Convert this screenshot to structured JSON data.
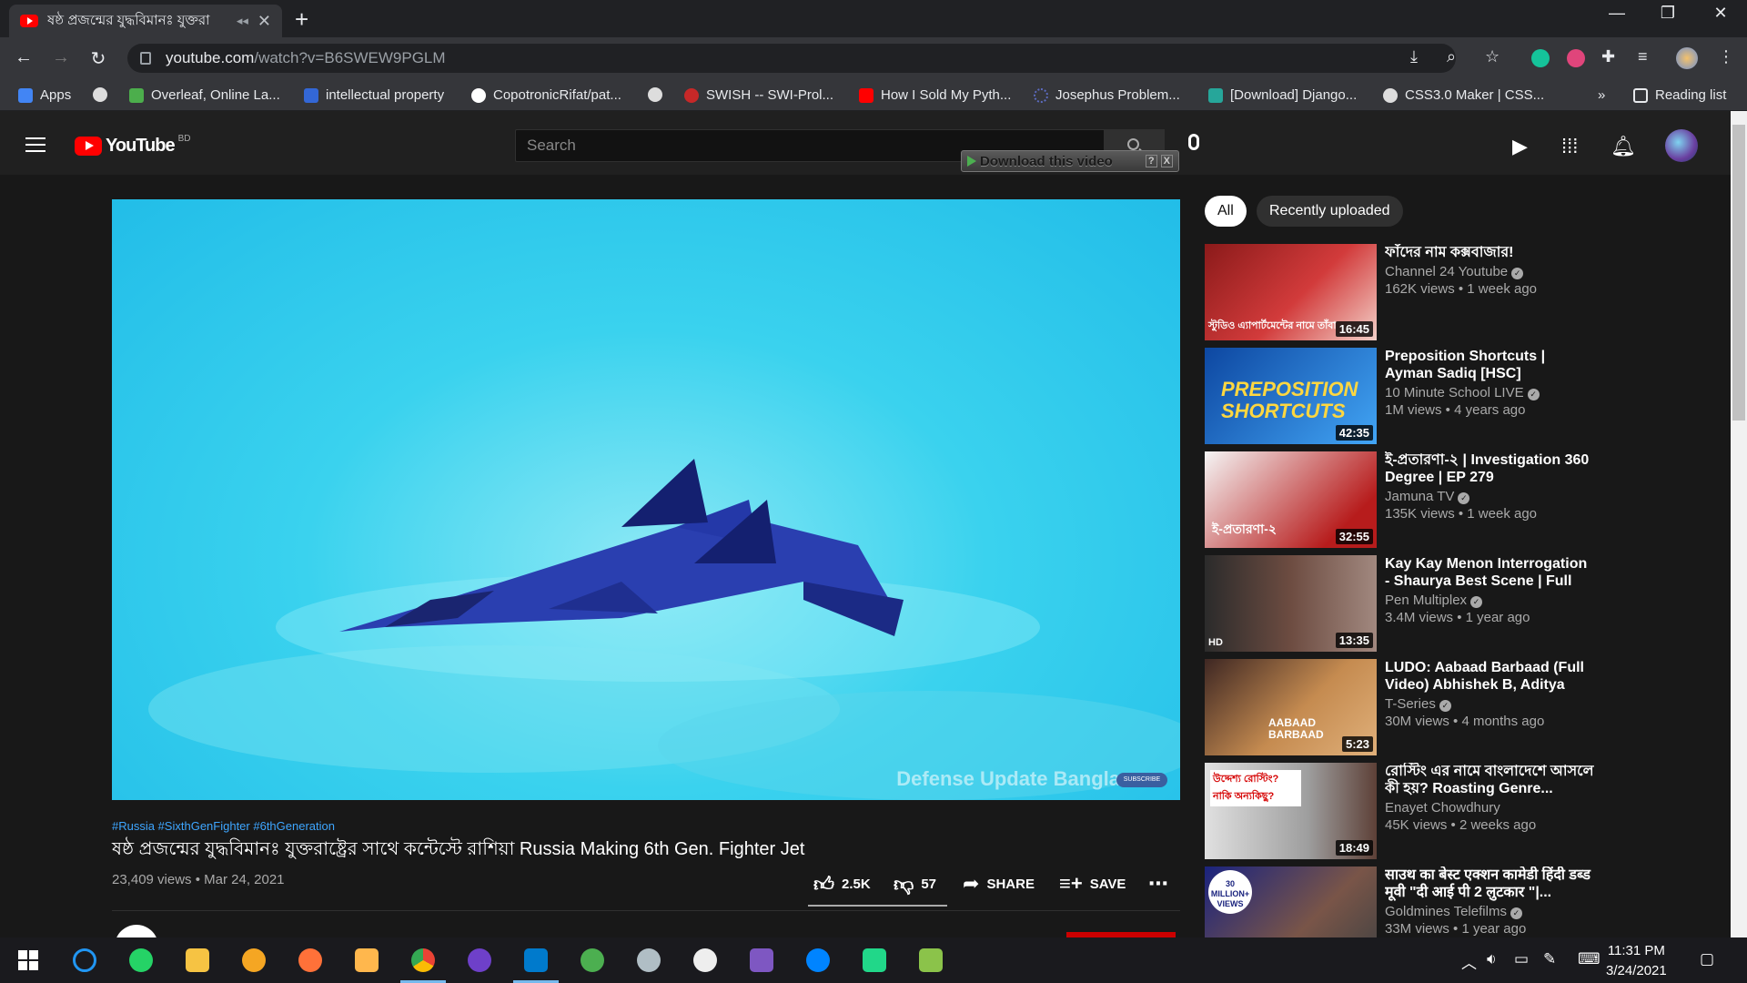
{
  "browser": {
    "tab_title": "ষষ্ঠ প্রজন্মের যুদ্ধবিমানঃ যুক্তরা",
    "url_host": "youtube.com",
    "url_path": "/watch?v=B6SWEW9PGLM",
    "bookmarks": [
      {
        "label": "Apps",
        "color": "#4285f4"
      },
      {
        "label": "",
        "color": "#dddddd"
      },
      {
        "label": "Overleaf, Online La...",
        "color": "#4cae4c"
      },
      {
        "label": "intellectual property",
        "color": "#3367d6"
      },
      {
        "label": "CopotronicRifat/pat...",
        "color": "#ffffff"
      },
      {
        "label": "",
        "color": "#dddddd"
      },
      {
        "label": "SWISH -- SWI-Prol...",
        "color": "#c62828"
      },
      {
        "label": "How I Sold My Pyth...",
        "color": "#ff0000"
      },
      {
        "label": "Josephus Problem...",
        "color": "#5c6bc0"
      },
      {
        "label": "[Download] Django...",
        "color": "#26a69a"
      },
      {
        "label": "CSS3.0 Maker | CSS...",
        "color": "#dddddd"
      }
    ],
    "bookmarks_more": "»",
    "reading_list": "Reading list"
  },
  "youtube": {
    "logo_text": "YouTube",
    "country_code": "BD",
    "search_placeholder": "Search",
    "download_widget": "Download this video",
    "download_help": "?",
    "download_close": "X"
  },
  "video": {
    "watermark": "Defense Update Bangla",
    "subscribe_badge": "SUBSCRIBE",
    "hashtags": "#Russia #SixthGenFighter #6thGeneration",
    "title": "ষষ্ঠ প্রজন্মের যুদ্ধবিমানঃ যুক্তরাষ্ট্রের সাথে কন্টেস্টে রাশিয়া Russia Making 6th Gen. Fighter Jet",
    "views_date": "23,409 views • Mar 24, 2021",
    "likes": "2.5K",
    "dislikes": "57",
    "share_label": "SHARE",
    "save_label": "SAVE"
  },
  "chips": [
    "All",
    "Recently uploaded"
  ],
  "recommendations": [
    {
      "title": "ফাঁদের নাম কক্সবাজার!",
      "channel": "Channel 24 Youtube",
      "stats": "162K views • 1 week ago",
      "duration": "16:45",
      "thumb_text": "স্টুডিও এ্যাপার্টমেন্টের নামে তাঁবা",
      "thumb_color": "#8b1a1a"
    },
    {
      "title": "Preposition Shortcuts | Ayman Sadiq [HSC]",
      "channel": "10 Minute School LIVE",
      "stats": "1M views • 4 years ago",
      "duration": "42:35",
      "thumb_text": "PREPOSITION SHORTCUTS",
      "thumb_color": "#1e6fd0"
    },
    {
      "title": "ই-প্রতারণা-২ | Investigation 360 Degree | EP 279",
      "channel": "Jamuna TV",
      "stats": "135K views • 1 week ago",
      "duration": "32:55",
      "thumb_text": "ই-প্রতারণা-২",
      "thumb_color": "#b71c1c"
    },
    {
      "title": "Kay Kay Menon Interrogation - Shaurya Best Scene | Full Hind...",
      "channel": "Pen Multiplex",
      "stats": "3.4M views • 1 year ago",
      "duration": "13:35",
      "thumb_text": "HD",
      "thumb_color": "#4e3b2e"
    },
    {
      "title": "LUDO: Aabaad Barbaad (Full Video) Abhishek B, Aditya K,...",
      "channel": "T-Series",
      "stats": "30M views • 4 months ago",
      "duration": "5:23",
      "thumb_text": "AABAAD BARBAAD",
      "thumb_color": "#8d5a2b"
    },
    {
      "title": "রোস্টিং এর নামে বাংলাদেশে আসলে কী হয়? Roasting Genre...",
      "channel": "Enayet Chowdhury",
      "stats": "45K views • 2 weeks ago",
      "duration": "18:49",
      "thumb_text": "উদ্দেশ্য রোস্টিং? নাকি অন্যকিছু?",
      "thumb_color": "#cfcfcf"
    },
    {
      "title": "साउथ का बेस्ट एक्शन कामेडी हिंदी डब्ड मूवी \"दी आई पी 2 लुटकार \"|...",
      "channel": "Goldmines Telefilms",
      "stats": "33M views • 1 year ago",
      "duration": "",
      "thumb_text": "30 MILLION+ VIEWS",
      "thumb_color": "#3b3b4f"
    }
  ],
  "taskbar": {
    "time": "11:31 PM",
    "date": "3/24/2021"
  }
}
